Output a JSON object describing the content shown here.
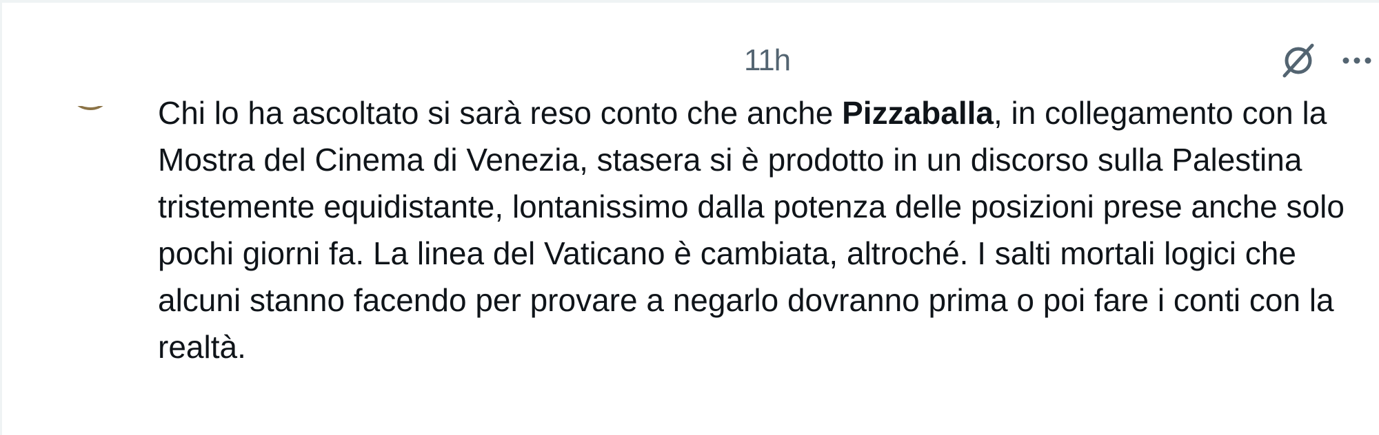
{
  "post": {
    "timestamp": "11h",
    "text_before_mention": "Chi lo ha ascoltato si sarà reso conto che anche ",
    "mention": "Pizzaballa",
    "text_after_mention": ", in collegamento con la Mostra del Cinema di Venezia, stasera si è prodotto in un discorso sulla Palestina tristemente equidistante, lontanissimo dalla potenza delle posizioni prese anche solo pochi giorni fa. La linea del Vaticano è cambiata, altroché. I salti mortali logici che alcuni stanno facendo per provare a negarlo dovranno prima o poi fare i conti con la realtà."
  },
  "icons": {
    "grok": "grok-icon",
    "more": "more-horizontal-icon"
  },
  "colors": {
    "text": "#0f1419",
    "secondary": "#536471",
    "avatar_accent": "#8b7346"
  }
}
